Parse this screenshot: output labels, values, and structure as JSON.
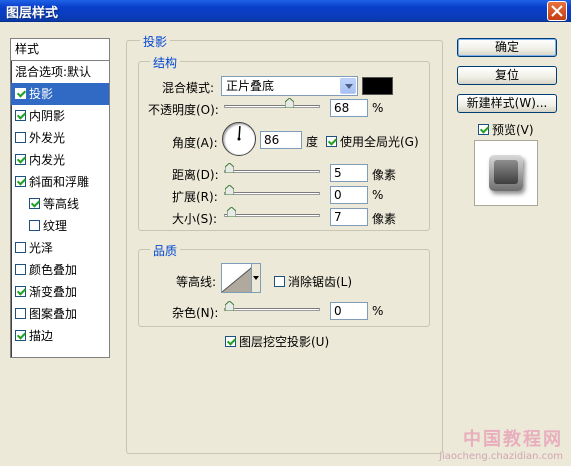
{
  "window": {
    "title": "图层样式"
  },
  "style_list": {
    "header": "样式",
    "items": [
      {
        "label": "混合选项:默认",
        "checkbox": false,
        "checked": false,
        "indent": false,
        "selected": false
      },
      {
        "label": "投影",
        "checkbox": true,
        "checked": true,
        "indent": false,
        "selected": true
      },
      {
        "label": "内阴影",
        "checkbox": true,
        "checked": true,
        "indent": false,
        "selected": false
      },
      {
        "label": "外发光",
        "checkbox": true,
        "checked": false,
        "indent": false,
        "selected": false
      },
      {
        "label": "内发光",
        "checkbox": true,
        "checked": true,
        "indent": false,
        "selected": false
      },
      {
        "label": "斜面和浮雕",
        "checkbox": true,
        "checked": true,
        "indent": false,
        "selected": false
      },
      {
        "label": "等高线",
        "checkbox": true,
        "checked": true,
        "indent": true,
        "selected": false
      },
      {
        "label": "纹理",
        "checkbox": true,
        "checked": false,
        "indent": true,
        "selected": false
      },
      {
        "label": "光泽",
        "checkbox": true,
        "checked": false,
        "indent": false,
        "selected": false
      },
      {
        "label": "颜色叠加",
        "checkbox": true,
        "checked": false,
        "indent": false,
        "selected": false
      },
      {
        "label": "渐变叠加",
        "checkbox": true,
        "checked": true,
        "indent": false,
        "selected": false
      },
      {
        "label": "图案叠加",
        "checkbox": true,
        "checked": false,
        "indent": false,
        "selected": false
      },
      {
        "label": "描边",
        "checkbox": true,
        "checked": true,
        "indent": false,
        "selected": false
      }
    ]
  },
  "drop_shadow": {
    "group_title": "投影",
    "structure": {
      "title": "结构",
      "blend_mode_label": "混合模式:",
      "blend_mode_value": "正片叠底",
      "shadow_color": "#000000",
      "opacity_label": "不透明度(O):",
      "opacity_value": "68",
      "opacity_unit": "%",
      "opacity_level": 0.68,
      "angle_label": "角度(A):",
      "angle_value": "86",
      "angle_unit": "度",
      "global_light_label": "使用全局光(G)",
      "global_light_checked": true,
      "distance_label": "距离(D):",
      "distance_value": "5",
      "distance_unit": "像素",
      "spread_label": "扩展(R):",
      "spread_value": "0",
      "spread_unit": "%",
      "size_label": "大小(S):",
      "size_value": "7",
      "size_unit": "像素"
    },
    "quality": {
      "title": "品质",
      "contour_label": "等高线:",
      "anti_alias_label": "消除锯齿(L)",
      "anti_alias_checked": false,
      "noise_label": "杂色(N):",
      "noise_value": "0",
      "noise_unit": "%"
    },
    "knockout_label": "图层挖空投影(U)",
    "knockout_checked": true
  },
  "buttons": {
    "ok": "确定",
    "reset": "复位",
    "new_style": "新建样式(W)...",
    "preview_label": "预览(V)",
    "preview_checked": true
  },
  "watermark": {
    "line1": "中国教程网",
    "line2": "jiaocheng.chazidian.com"
  },
  "colors": {
    "selection": "#316ac5",
    "group_title": "#0046d5",
    "title_bar": "#0a3fc9"
  }
}
